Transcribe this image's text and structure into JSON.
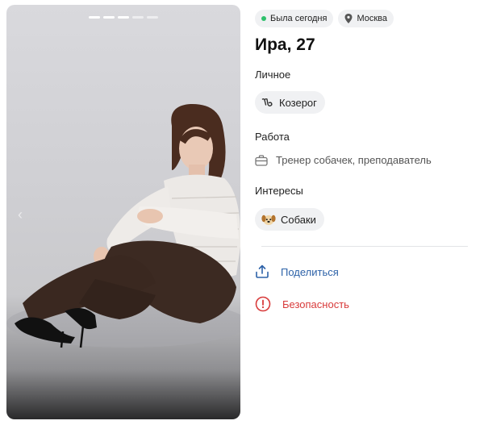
{
  "profile": {
    "status": "Была сегодня",
    "city": "Москва",
    "name_age": "Ира, 27"
  },
  "sections": {
    "personal_label": "Личное",
    "zodiac": "Козерог",
    "work_label": "Работа",
    "work": "Тренер собачек, преподаватель",
    "interests_label": "Интересы",
    "interest": "Собаки"
  },
  "actions": {
    "share": "Поделиться",
    "safety": "Безопасность"
  },
  "gallery": {
    "photo_count": 5,
    "active_photo": 3
  },
  "colors": {
    "online": "#2ec06b",
    "share": "#2d62a8",
    "safety": "#d83a3a",
    "chip_bg": "#f0f1f3"
  },
  "icons": [
    "online-dot",
    "location-pin-icon",
    "capricorn-icon",
    "briefcase-icon",
    "dog-emoji-icon",
    "share-icon",
    "alert-circle-icon"
  ]
}
